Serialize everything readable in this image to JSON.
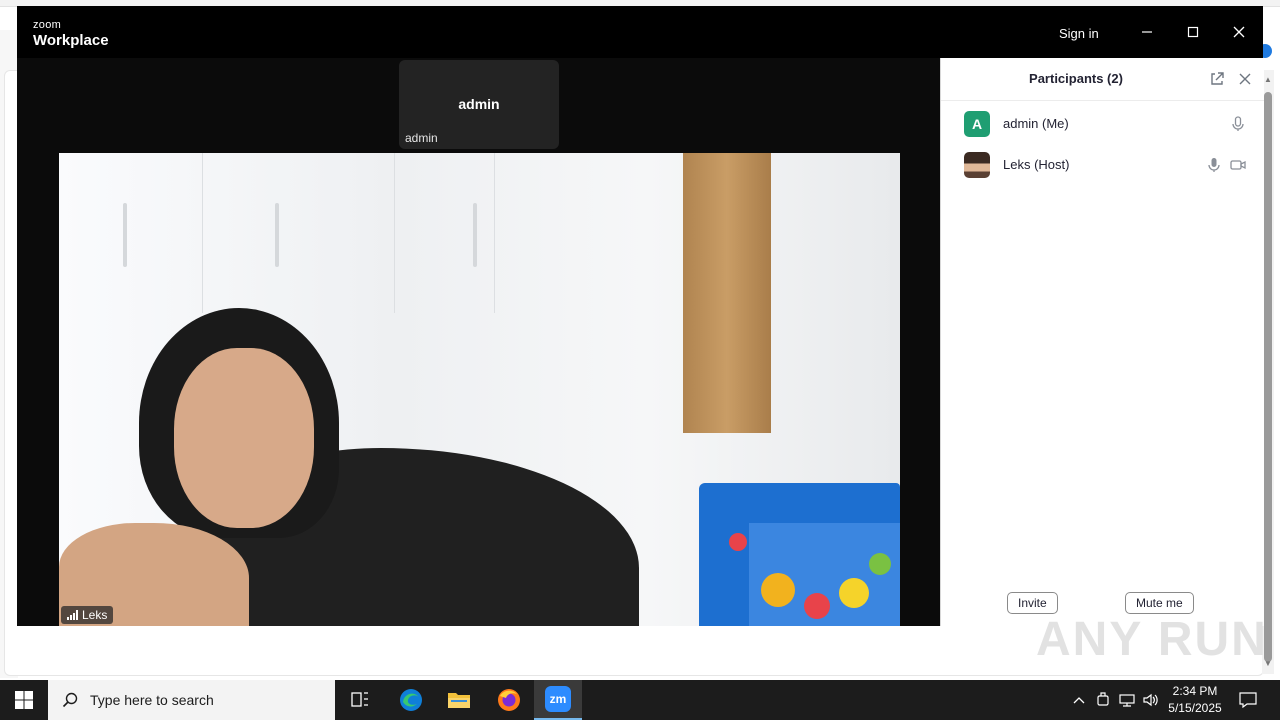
{
  "window": {
    "logo_line1": "zoom",
    "logo_line2": "Workplace",
    "sign_in": "Sign in"
  },
  "meeting": {
    "self_tile_name": "admin",
    "self_tile_label": "admin",
    "speaker_label": "Leks"
  },
  "participants": {
    "title": "Participants (2)",
    "items": [
      {
        "name": "admin (Me)",
        "avatar_letter": "A",
        "avatar_color": "#1f9e72",
        "icons": [
          "microphone-icon"
        ]
      },
      {
        "name": "Leks (Host)",
        "avatar_letter": "",
        "icons": [
          "microphone-icon",
          "video-camera-icon"
        ]
      }
    ],
    "invite_label": "Invite",
    "mute_label": "Mute me"
  },
  "taskbar": {
    "search_placeholder": "Type here to search",
    "time": "2:34 PM",
    "date": "5/15/2025",
    "zoom_app_label": "zm"
  },
  "watermark": "ANY RUN",
  "colors": {
    "accent": "#1f9e72",
    "zoom_blue": "#2d8cff",
    "taskbar": "#1c1c1c"
  }
}
